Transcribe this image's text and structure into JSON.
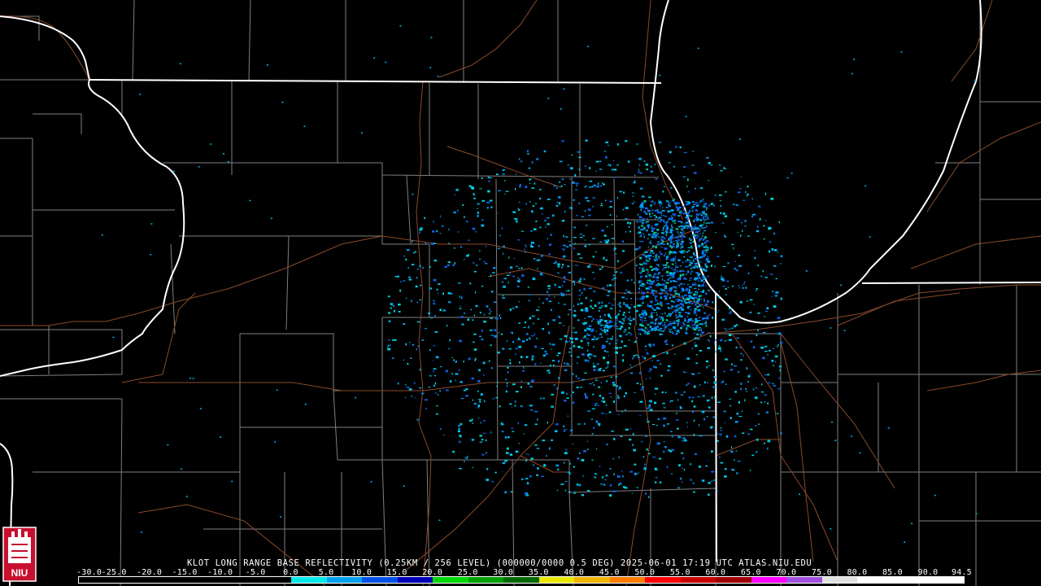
{
  "product": {
    "title": "KLOT LONG RANGE BASE REFLECTIVITY (0.25KM / 256 LEVEL) (000000/0000 0.5 DEG) 2025-06-01 17:19 UTC  ATLAS.NIU.EDU"
  },
  "colorbar": {
    "ticks": [
      "-30.0",
      "-25.0",
      "-20.0",
      "-15.0",
      "-10.0",
      "-5.0",
      "0.0",
      "5.0",
      "10.0",
      "15.0",
      "20.0",
      "25.0",
      "30.0",
      "35.0",
      "40.0",
      "45.0",
      "50.0",
      "55.0",
      "60.0",
      "65.0",
      "70.0",
      "75.0",
      "80.0",
      "85.0",
      "90.0",
      "94.5"
    ],
    "colors": [
      "#000000",
      "#000000",
      "#000000",
      "#000000",
      "#000000",
      "#000000",
      "#00e8e8",
      "#00a0f0",
      "#0050e8",
      "#0000b8",
      "#00d800",
      "#00a000",
      "#006800",
      "#e8e800",
      "#f0b400",
      "#ff7a00",
      "#ff0000",
      "#c80000",
      "#a00000",
      "#ff00ff",
      "#a050e0",
      "#e0e0e0",
      "#ffffff",
      "#ffffff",
      "#ffffff"
    ]
  },
  "logo": {
    "text": "NIU",
    "name": "niu-logo-icon"
  }
}
